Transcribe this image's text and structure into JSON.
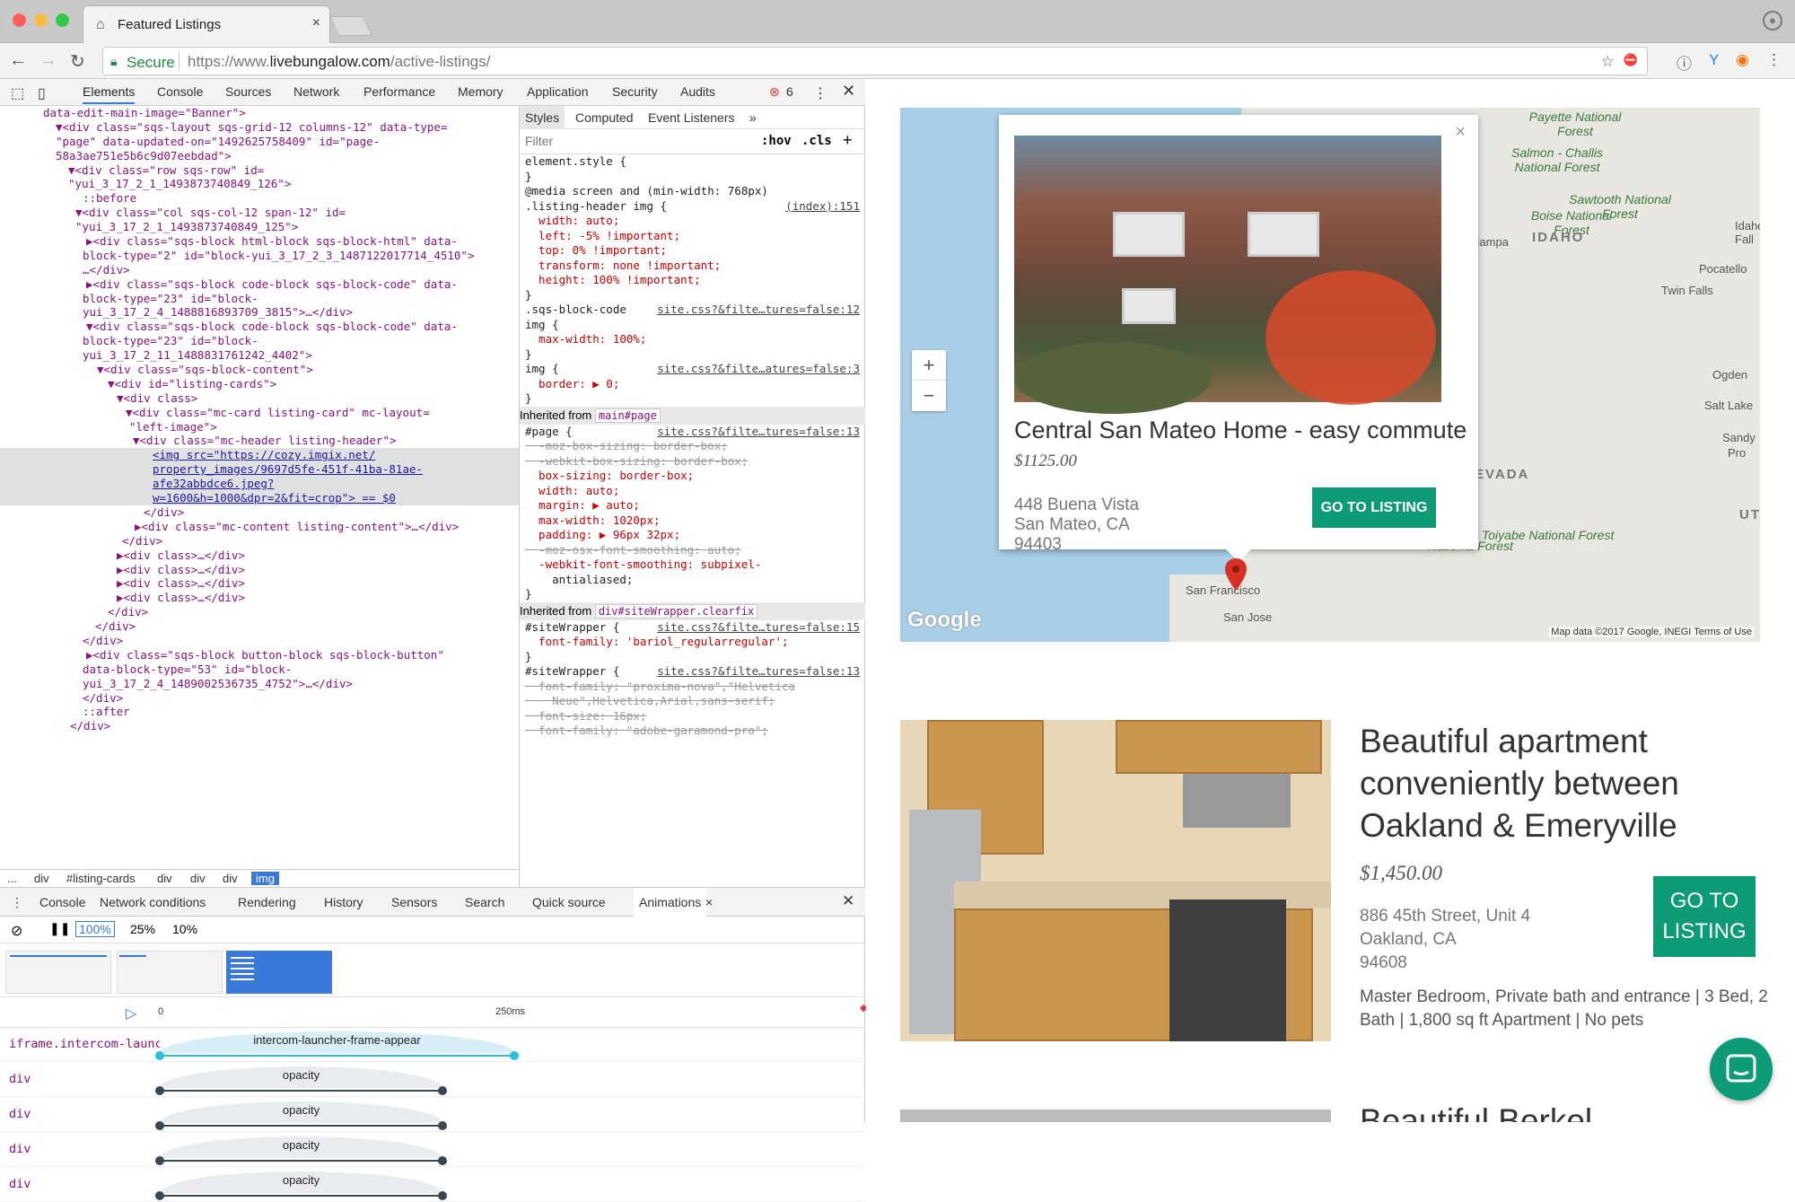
{
  "browser": {
    "tab_title": "Featured Listings",
    "secure_label": "Secure",
    "url_prefix": "https://www.",
    "url_domain": "livebungalow.com",
    "url_path": "/active-listings/"
  },
  "devtools": {
    "tabs": [
      "Elements",
      "Console",
      "Sources",
      "Network",
      "Performance",
      "Memory",
      "Application",
      "Security",
      "Audits"
    ],
    "error_count": "6",
    "breadcrumbs": [
      "...",
      "div",
      "#listing-cards",
      "div",
      "div",
      "div",
      "img"
    ],
    "dom_lines": [
      "data-edit-main-image=\"Banner\">",
      "▼<div class=\"sqs-layout sqs-grid-12 columns-12\" data-type=",
      "\"page\" data-updated-on=\"1492625758409\" id=\"page-",
      "58a3ae751e5b6c9d07eebdad\">",
      "▼<div class=\"row sqs-row\" id=",
      "\"yui_3_17_2_1_1493873740849_126\">",
      "::before",
      "▼<div class=\"col sqs-col-12 span-12\" id=",
      "\"yui_3_17_2_1_1493873740849_125\">",
      "▶<div class=\"sqs-block html-block sqs-block-html\" data-",
      "block-type=\"2\" id=\"block-yui_3_17_2_3_1487122017714_4510\">",
      "…</div>",
      "▶<div class=\"sqs-block code-block sqs-block-code\" data-",
      "block-type=\"23\" id=\"block-",
      "yui_3_17_2_4_1488816893709_3815\">…</div>",
      "▼<div class=\"sqs-block code-block sqs-block-code\" data-",
      "block-type=\"23\" id=\"block-",
      "yui_3_17_2_11_1488831761242_4402\">",
      "▼<div class=\"sqs-block-content\">",
      "▼<div id=\"listing-cards\">",
      "▼<div class>",
      "▼<div class=\"mc-card listing-card\" mc-layout=",
      "\"left-image\">",
      "▼<div class=\"mc-header listing-header\">",
      "<img src=\"https://cozy.imgix.net/",
      "property_images/9697d5fe-451f-41ba-81ae-",
      "afe32abbdce6.jpeg?",
      "w=1600&h=1000&dpr=2&fit=crop\"> == $0",
      "</div>",
      "▶<div class=\"mc-content listing-content\">…</div>",
      "</div>",
      "▶<div class>…</div>",
      "▶<div class>…</div>",
      "▶<div class>…</div>",
      "▶<div class>…</div>",
      "</div>",
      "</div>",
      "</div>",
      "▶<div class=\"sqs-block button-block sqs-block-button\"",
      "data-block-type=\"53\" id=\"block-",
      "yui_3_17_2_4_1489002536735_4752\">…</div>",
      "</div>",
      "::after",
      "</div>"
    ],
    "styles_tabs": [
      "Styles",
      "Computed",
      "Event Listeners"
    ],
    "filter_placeholder": "Filter",
    "hov": ":hov",
    "cls": ".cls",
    "style_rules": [
      {
        "t": "element.style {"
      },
      {
        "t": "}"
      },
      {
        "t": "@media screen and (min-width: 768px)"
      },
      {
        "t": ".listing-header img {",
        "src": "(index):151"
      },
      {
        "t": "  width: auto;",
        "p": 1
      },
      {
        "t": "  left: -5% !important;",
        "p": 1
      },
      {
        "t": "  top: 0% !important;",
        "p": 1
      },
      {
        "t": "  transform: none !important;",
        "p": 1
      },
      {
        "t": "  height: 100% !important;",
        "p": 1
      },
      {
        "t": "}"
      },
      {
        "t": ".sqs-block-code",
        "src": "site.css?&filte…tures=false:12"
      },
      {
        "t": "img {"
      },
      {
        "t": "  max-width: 100%;",
        "p": 1
      },
      {
        "t": "}"
      },
      {
        "t": "img {",
        "src": "site.css?&filte…atures=false:3"
      },
      {
        "t": "  border: ▶ 0;",
        "p": 1
      },
      {
        "t": "}"
      }
    ],
    "inherited1": "main#page",
    "page_rules": [
      {
        "t": "#page {",
        "src": "site.css?&filte…tures=false:13"
      },
      {
        "t": "  -moz-box-sizing: border-box;",
        "s": 1
      },
      {
        "t": "  -webkit-box-sizing: border-box;",
        "s": 1
      },
      {
        "t": "  box-sizing: border-box;",
        "p": 1
      },
      {
        "t": "  width: auto;",
        "p": 1
      },
      {
        "t": "  margin: ▶ auto;",
        "p": 1
      },
      {
        "t": "  max-width: 1020px;",
        "p": 1
      },
      {
        "t": "  padding: ▶ 96px 32px;",
        "p": 1
      },
      {
        "t": "  -moz-osx-font-smoothing: auto;",
        "s": 1
      },
      {
        "t": "  -webkit-font-smoothing: subpixel-",
        "p": 1
      },
      {
        "t": "    antialiased;"
      },
      {
        "t": "}"
      }
    ],
    "inherited2": "div#siteWrapper.clearfix",
    "wrapper_rules": [
      {
        "t": "#siteWrapper {",
        "src": "site.css?&filte…tures=false:15"
      },
      {
        "t": "  font-family: 'bariol_regularregular';",
        "p": 1
      },
      {
        "t": "}"
      },
      {
        "t": "#siteWrapper {",
        "src": "site.css?&filte…tures=false:13"
      },
      {
        "t": "  font-family: \"proxima-nova\",\"Helvetica",
        "s": 1
      },
      {
        "t": "    Neue\",Helvetica,Arial,sans-serif;",
        "s": 1
      },
      {
        "t": "  font-size: 16px;",
        "s": 1
      },
      {
        "t": "  font-family: \"adobe-garamond-pro\";",
        "s": 1
      }
    ],
    "drawer_tabs": [
      "Console",
      "Network conditions",
      "Rendering",
      "History",
      "Sensors",
      "Search",
      "Quick source",
      "Animations"
    ],
    "speeds": [
      "100%",
      "25%",
      "10%"
    ],
    "timeline_start": "0",
    "timeline_mark": "250ms",
    "animations": [
      {
        "node": "iframe.intercom-launch",
        "name": "intercom-launcher-frame-appear"
      },
      {
        "node": "div",
        "name": "opacity"
      },
      {
        "node": "div",
        "name": "opacity"
      },
      {
        "node": "div",
        "name": "opacity"
      },
      {
        "node": "div",
        "name": "opacity"
      }
    ]
  },
  "map": {
    "labels": [
      "Payette National Forest",
      "Salmon - Challis National Forest",
      "Sawtooth National Forest",
      "Boise National Forest",
      "Nampa",
      "IDAHO",
      "Idaho Fall",
      "Pocatello",
      "Twin Falls",
      "Ogden",
      "Salt Lake",
      "Sandy",
      "Pro",
      "EVADA",
      "UTA",
      "Toiyabe National Forest",
      "National Forest",
      "San Francisco",
      "San Jose"
    ],
    "google": "Google",
    "attribution": "Map data ©2017 Google, INEGI    Terms of Use",
    "zoom_in": "+",
    "zoom_out": "−"
  },
  "popup": {
    "title": "Central San Mateo Home - easy commute",
    "price": "$1125.00",
    "address1": "448 Buena Vista",
    "address2": "San Mateo, CA",
    "zip": "94403",
    "button": "GO TO LISTING",
    "close": "×"
  },
  "listing2": {
    "title": "Beautiful apartment conveniently between Oakland & Emeryville",
    "price": "$1,450.00",
    "address1": "886 45th Street, Unit 4",
    "address2": "Oakland, CA",
    "zip": "94608",
    "button_line1": "GO TO",
    "button_line2": "LISTING",
    "description": "Master Bedroom, Private bath and entrance | 3 Bed, 2 Bath | 1,800 sq ft Apartment | No pets"
  },
  "listing3": {
    "title": "Beautiful Berkel"
  }
}
